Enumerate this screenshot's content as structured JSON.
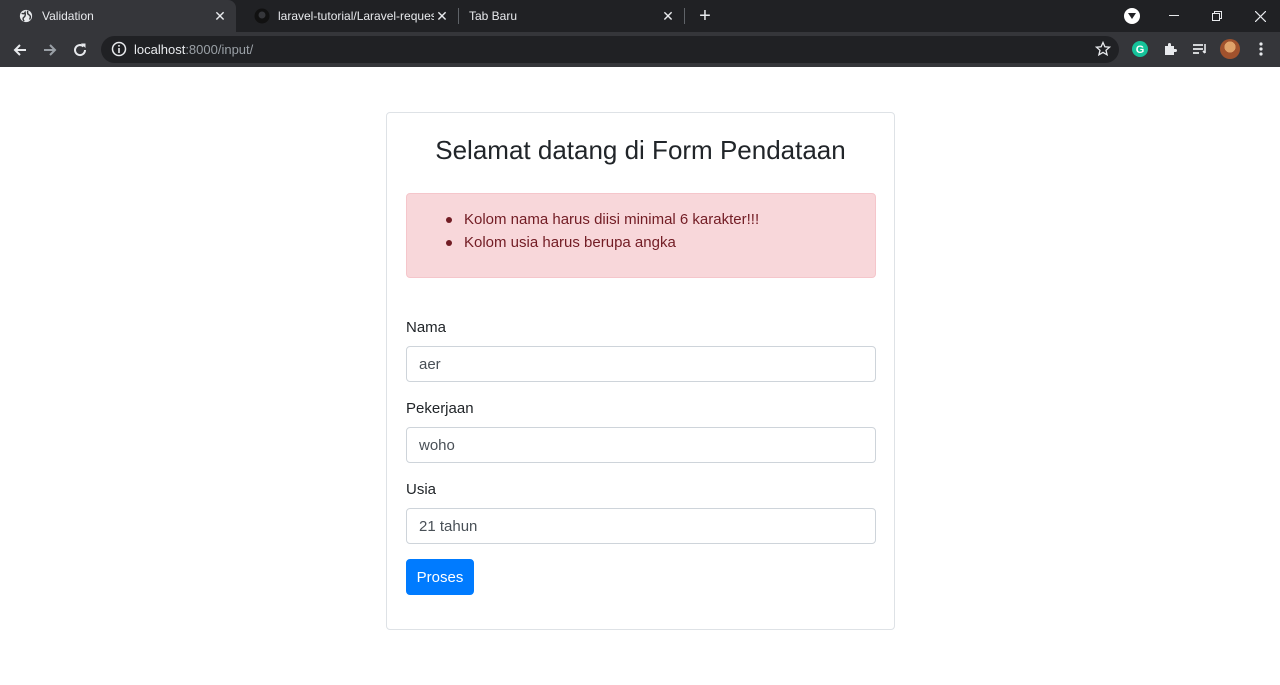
{
  "browser": {
    "tabs": [
      {
        "title": "Validation",
        "favicon": "globe-icon",
        "active": true
      },
      {
        "title": "laravel-tutorial/Laravel-request-v",
        "favicon": "github-icon",
        "active": false
      },
      {
        "title": "Tab Baru",
        "favicon": "",
        "active": false
      }
    ],
    "new_tab_icon": "plus-icon",
    "url_host": "localhost",
    "url_path": ":8000/input/"
  },
  "page": {
    "title": "Selamat datang di Form Pendataan",
    "errors": [
      "Kolom nama harus diisi minimal 6 karakter!!!",
      "Kolom usia harus berupa angka"
    ],
    "fields": [
      {
        "label": "Nama",
        "value": "aer"
      },
      {
        "label": "Pekerjaan",
        "value": "woho"
      },
      {
        "label": "Usia",
        "value": "21 tahun"
      }
    ],
    "submit_label": "Proses"
  },
  "colors": {
    "alert_bg": "#f8d7da",
    "alert_text": "#721c24",
    "primary": "#007bff"
  }
}
